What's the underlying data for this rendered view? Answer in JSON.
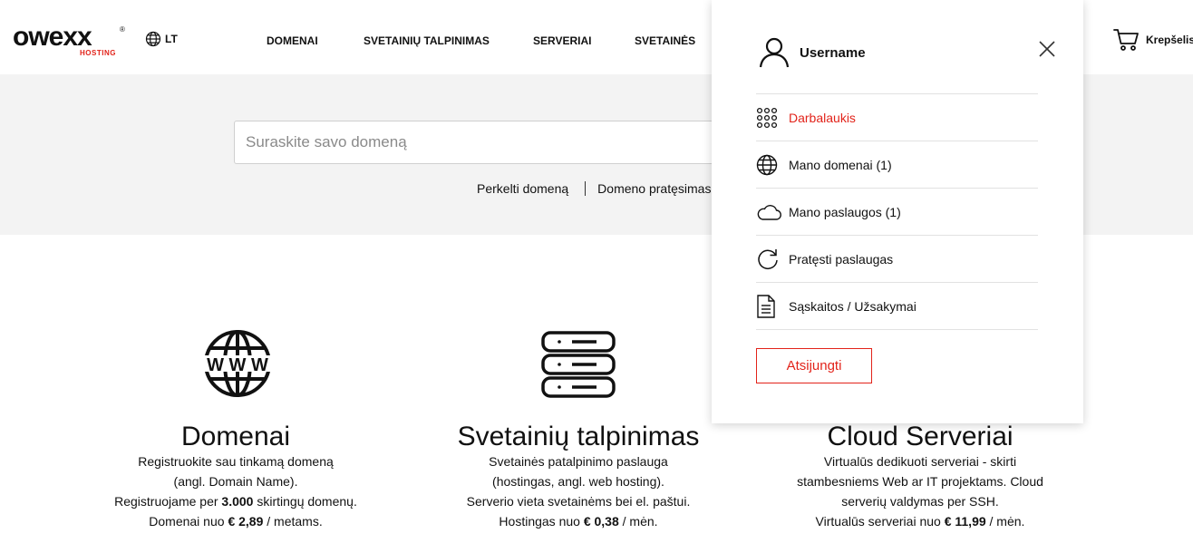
{
  "header": {
    "logo": {
      "word": "owexx",
      "sub": "HOSTING",
      "reg": "®"
    },
    "lang": "LT",
    "nav": [
      "DOMENAI",
      "SVETAINIŲ TALPINIMAS",
      "SERVERIAI",
      "SVETAINĖS"
    ],
    "cart_label": "Krepšelis"
  },
  "search": {
    "placeholder": "Suraskite savo domeną",
    "links": [
      "Perkelti domeną",
      "Domeno pratęsimas"
    ]
  },
  "services": [
    {
      "icon": "www-globe-icon",
      "title": "Domenai",
      "lines": [
        {
          "parts": [
            {
              "t": "Registruokite sau tinkamą domeną"
            }
          ]
        },
        {
          "parts": [
            {
              "t": "(angl. Domain Name)."
            }
          ]
        },
        {
          "parts": [
            {
              "t": "Registruojame per "
            },
            {
              "t": "3.000",
              "b": true
            },
            {
              "t": " skirtingų domenų."
            }
          ]
        },
        {
          "parts": [
            {
              "t": "Domenai nuo "
            },
            {
              "t": "€ 2,89",
              "b": true
            },
            {
              "t": " / metams."
            }
          ]
        }
      ]
    },
    {
      "icon": "server-icon",
      "title": "Svetainių talpinimas",
      "lines": [
        {
          "parts": [
            {
              "t": "Svetainės patalpinimo paslauga"
            }
          ]
        },
        {
          "parts": [
            {
              "t": "(hostingas, angl. web hosting)."
            }
          ]
        },
        {
          "parts": [
            {
              "t": "Serverio vieta svetainėms bei el. paštui."
            }
          ]
        },
        {
          "parts": [
            {
              "t": "Hostingas nuo "
            },
            {
              "t": "€ 0,38",
              "b": true
            },
            {
              "t": " / mėn."
            }
          ]
        }
      ]
    },
    {
      "icon": "",
      "title": "Cloud Serveriai",
      "lines": [
        {
          "parts": [
            {
              "t": "Virtualūs dedikuoti serveriai - skirti"
            }
          ]
        },
        {
          "parts": [
            {
              "t": "stambesniems Web ar IT projektams. Cloud"
            }
          ]
        },
        {
          "parts": [
            {
              "t": "serverių valdymas per SSH."
            }
          ]
        },
        {
          "parts": [
            {
              "t": "Virtualūs serveriai nuo "
            },
            {
              "t": "€ 11,99",
              "b": true
            },
            {
              "t": " / mėn."
            }
          ]
        }
      ]
    }
  ],
  "dropdown": {
    "username": "Username",
    "items": [
      {
        "label": "Darbalaukis",
        "icon": "grid-dots-icon",
        "active": true
      },
      {
        "label": "Mano domenai (1)",
        "icon": "globe-icon",
        "active": false
      },
      {
        "label": "Mano paslaugos (1)",
        "icon": "cloud-icon",
        "active": false
      },
      {
        "label": "Pratęsti paslaugas",
        "icon": "refresh-icon",
        "active": false
      },
      {
        "label": "Sąskaitos / Užsakymai",
        "icon": "document-icon",
        "active": false
      }
    ],
    "logout": "Atsijungti"
  },
  "colors": {
    "accent": "#e2231a",
    "band": "#f3f3f3",
    "text": "#111111"
  }
}
